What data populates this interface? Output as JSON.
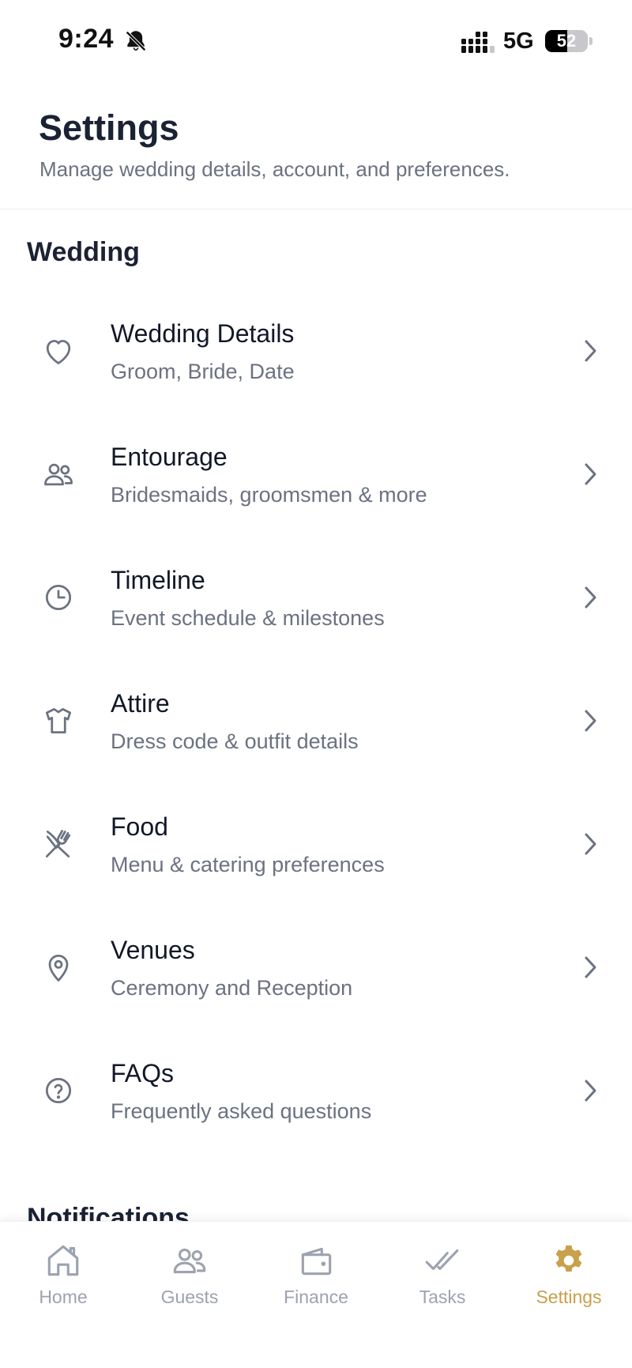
{
  "status_bar": {
    "time": "9:24",
    "network": "5G",
    "battery": "52",
    "battery_level_percent": 52
  },
  "header": {
    "title": "Settings",
    "subtitle": "Manage wedding details, account, and preferences."
  },
  "sections": {
    "wedding": {
      "title": "Wedding",
      "items": [
        {
          "title": "Wedding Details",
          "description": "Groom, Bride, Date",
          "icon": "heart-icon"
        },
        {
          "title": "Entourage",
          "description": "Bridesmaids, groomsmen & more",
          "icon": "people-icon"
        },
        {
          "title": "Timeline",
          "description": "Event schedule & milestones",
          "icon": "clock-icon"
        },
        {
          "title": "Attire",
          "description": "Dress code & outfit details",
          "icon": "shirt-icon"
        },
        {
          "title": "Food",
          "description": "Menu & catering preferences",
          "icon": "utensils-icon"
        },
        {
          "title": "Venues",
          "description": "Ceremony and Reception",
          "icon": "map-pin-icon"
        },
        {
          "title": "FAQs",
          "description": "Frequently asked questions",
          "icon": "help-circle-icon"
        }
      ]
    },
    "notifications": {
      "title": "Notifications"
    }
  },
  "tab_bar": {
    "tabs": [
      {
        "label": "Home",
        "icon": "home-icon"
      },
      {
        "label": "Guests",
        "icon": "users-icon"
      },
      {
        "label": "Finance",
        "icon": "wallet-icon"
      },
      {
        "label": "Tasks",
        "icon": "double-check-icon"
      },
      {
        "label": "Settings",
        "icon": "gear-icon"
      }
    ],
    "active": "Settings"
  },
  "colors": {
    "accent": "#c9a04b",
    "title": "#1a2233",
    "muted": "#6b7280",
    "icon": "#6b7280",
    "tab_inactive": "#9ca3af"
  }
}
